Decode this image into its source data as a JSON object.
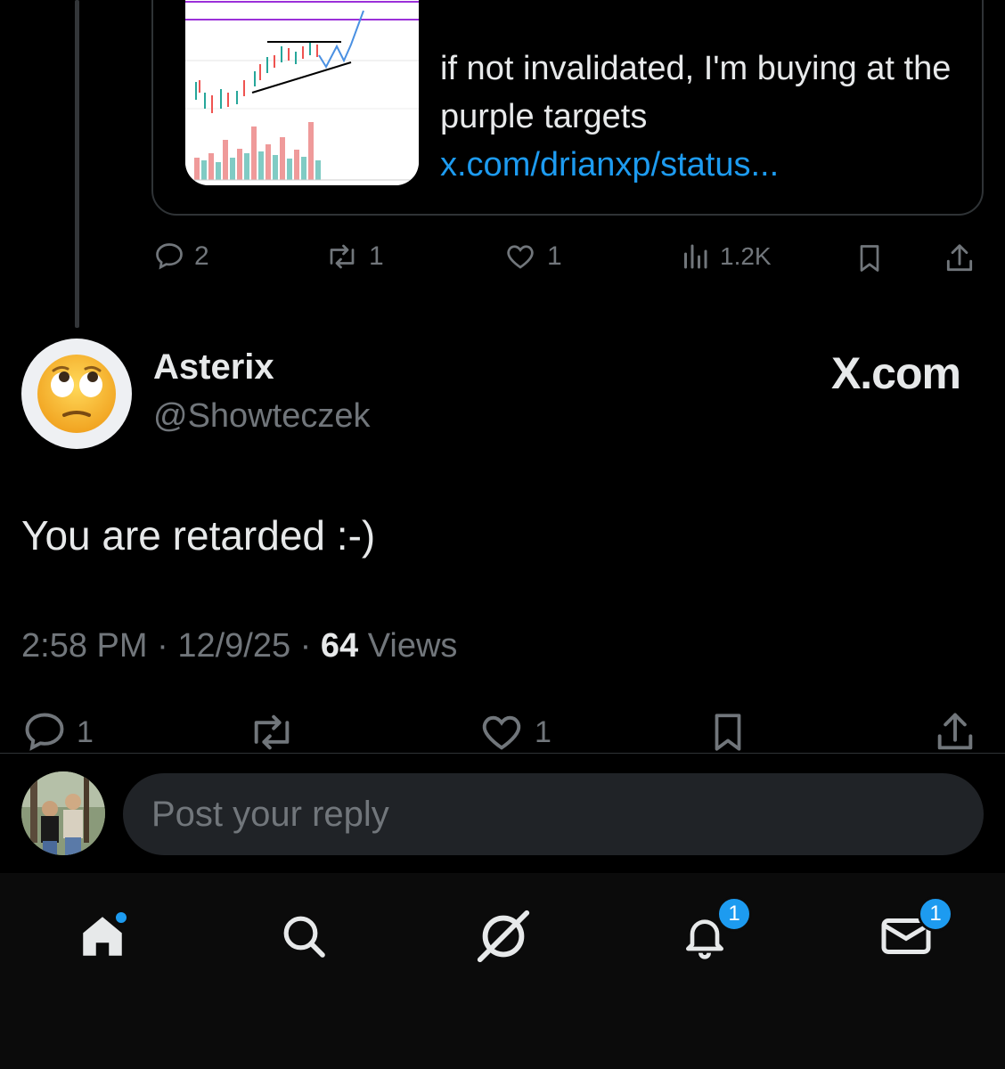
{
  "quote": {
    "text_plain": "if not invalidated, I'm buying at the purple targets ",
    "link_text": "x.com/drianxp/status..."
  },
  "parent_actions": {
    "replies": "2",
    "reposts": "1",
    "likes": "1",
    "views": "1.2K"
  },
  "post": {
    "author_name": "Asterix",
    "author_handle": "@Showteczek",
    "brand": "X.com",
    "text": "You are retarded :-)",
    "time": "2:58 PM",
    "date": "12/9/25",
    "views_count": "64",
    "views_label": "Views",
    "replies": "1",
    "likes": "1"
  },
  "reply": {
    "placeholder": "Post your reply"
  },
  "nav": {
    "notifications_badge": "1",
    "messages_badge": "1"
  },
  "colors": {
    "link": "#1d9bf0",
    "muted": "#71767b",
    "text": "#e7e9ea"
  }
}
